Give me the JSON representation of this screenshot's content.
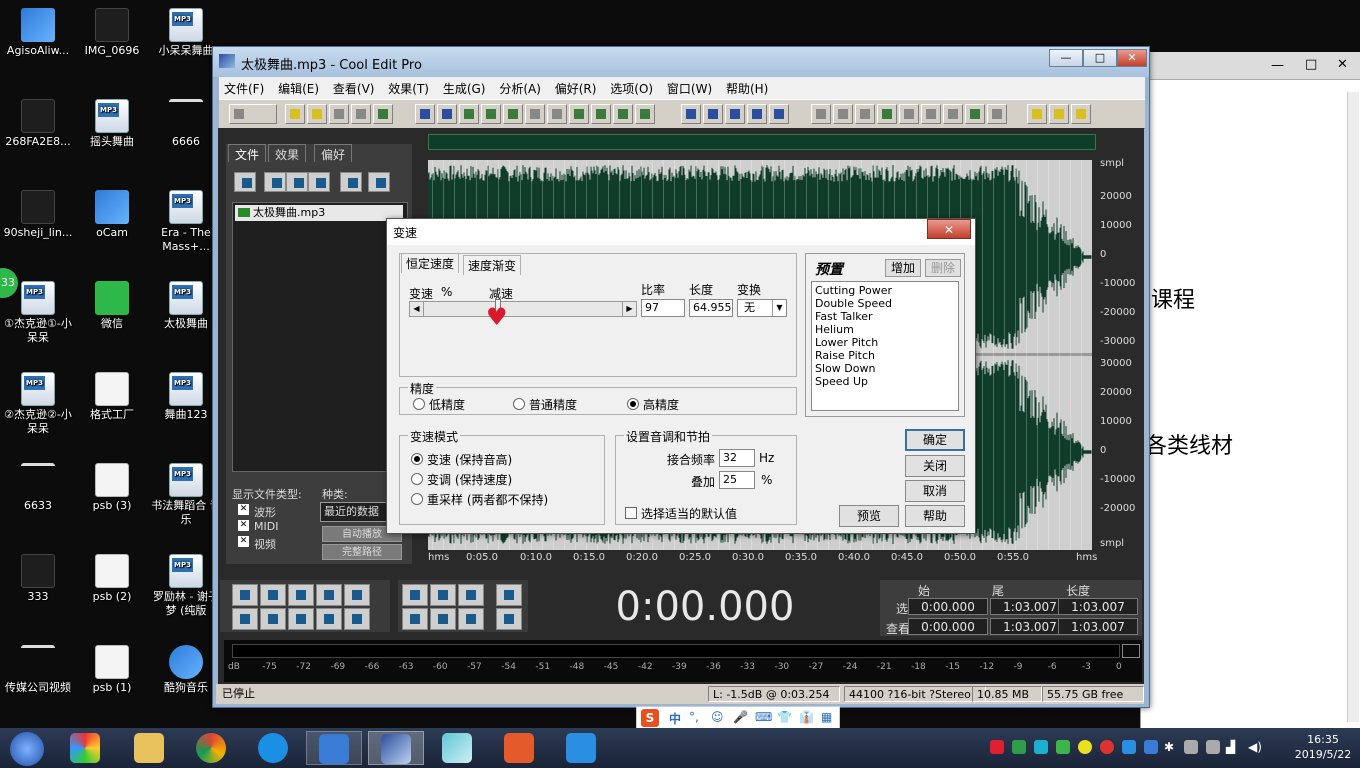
{
  "desktop": {
    "icons": [
      {
        "label": "AgisoAliw...",
        "icon": "mail-app-icon"
      },
      {
        "label": "IMG_0696",
        "icon": "image-file-icon"
      },
      {
        "label": "小呆呆舞曲",
        "icon": "mp3-file-icon"
      },
      {
        "label": "268FA2E8...",
        "icon": "image-file-icon"
      },
      {
        "label": "摇头舞曲",
        "icon": "mp3-file-icon"
      },
      {
        "label": "6666",
        "icon": "file-icon"
      },
      {
        "label": "90sheji_lin...",
        "icon": "image-file-icon"
      },
      {
        "label": "oCam",
        "icon": "ocam-app-icon"
      },
      {
        "label": "Era - The Mass+...",
        "icon": "mp3-file-icon"
      },
      {
        "label": "①杰克逊①-小呆呆",
        "icon": "mp3-file-icon"
      },
      {
        "label": "微信",
        "icon": "wechat-app-icon"
      },
      {
        "label": "太极舞曲",
        "icon": "mp3-file-icon"
      },
      {
        "label": "②杰克逊②-小呆呆",
        "icon": "mp3-file-icon"
      },
      {
        "label": "格式工厂",
        "icon": "format-factory-icon"
      },
      {
        "label": "舞曲123",
        "icon": "mp3-file-icon"
      },
      {
        "label": "6633",
        "icon": "file-icon"
      },
      {
        "label": "psb (3)",
        "icon": "document-icon"
      },
      {
        "label": "书法舞蹈合 音乐",
        "icon": "mp3-file-icon"
      },
      {
        "label": "333",
        "icon": "image-file-icon"
      },
      {
        "label": "psb (2)",
        "icon": "document-icon"
      },
      {
        "label": "罗励林 - 谢子梦 (纯版",
        "icon": "mp3-file-icon"
      },
      {
        "label": "传媒公司视频",
        "icon": "file-icon"
      },
      {
        "label": "psb (1)",
        "icon": "document-icon"
      },
      {
        "label": "酷狗音乐",
        "icon": "kugou-app-icon"
      }
    ],
    "badge": "33"
  },
  "bg_window": {
    "text1": "课程",
    "text2": "各类线材"
  },
  "app": {
    "title": "太极舞曲.mp3 - Cool Edit Pro",
    "win_buttons": [
      "—",
      "□",
      "✕"
    ],
    "menu": [
      "文件(F)",
      "编辑(E)",
      "查看(V)",
      "效果(T)",
      "生成(G)",
      "分析(A)",
      "偏好(R)",
      "选项(O)",
      "窗口(W)",
      "帮助(H)"
    ],
    "left_tabs": [
      "文件",
      "效果",
      "偏好"
    ],
    "file_item": "太极舞曲.mp3",
    "file_type_label": "显示文件类型:",
    "kind_label": "种类:",
    "file_types": [
      "波形",
      "MIDI",
      "视频"
    ],
    "recent_label": "最近的数据",
    "auto_play": "自动播放",
    "full_path": "完整路径",
    "y_ticks_top": [
      "smpl",
      "20000",
      "10000",
      "0",
      "-10000",
      "-20000",
      "-30000"
    ],
    "y_ticks_bottom": [
      "30000",
      "20000",
      "10000",
      "0",
      "-10000",
      "-20000",
      "smpl"
    ],
    "x_ticks": [
      "hms",
      "0:05.0",
      "0:10.0",
      "0:15.0",
      "0:20.0",
      "0:25.0",
      "0:30.0",
      "0:35.0",
      "0:40.0",
      "0:45.0",
      "0:50.0",
      "0:55.0",
      "hms"
    ],
    "time_display": "0:00.000",
    "sel": {
      "h_start": "始",
      "h_end": "尾",
      "h_len": "长度",
      "row1": "选",
      "row2": "查看",
      "sel_start": "0:00.000",
      "sel_end": "1:03.007",
      "sel_len": "1:03.007",
      "view_start": "0:00.000",
      "view_end": "1:03.007",
      "view_len": "1:03.007"
    },
    "meter_ticks": [
      "dB",
      "-75",
      "-72",
      "-69",
      "-66",
      "-63",
      "-60",
      "-57",
      "-54",
      "-51",
      "-48",
      "-45",
      "-42",
      "-39",
      "-36",
      "-33",
      "-30",
      "-27",
      "-24",
      "-21",
      "-18",
      "-15",
      "-12",
      "-9",
      "-6",
      "-3",
      "0"
    ],
    "status": {
      "state": "已停止",
      "level": "L: -1.5dB @   0:03.254",
      "format": "44100 ?16-bit ?Stereo",
      "size": "10.85 MB",
      "free": "55.75 GB free"
    }
  },
  "dialog": {
    "title": "变速",
    "close": "✕",
    "tabs": [
      "恒定速度",
      "速度渐变"
    ],
    "speed_label": "变速",
    "pct": "%",
    "slow_label": "减速",
    "ratio_label": "比率",
    "length_label": "长度",
    "transpose_label": "变换",
    "ratio_value": "97",
    "length_value": "64.955",
    "transpose_value": "无",
    "precision_label": "精度",
    "precision_options": [
      "低精度",
      "普通精度",
      "高精度"
    ],
    "precision_selected": 2,
    "mode_label": "变速模式",
    "mode_options": [
      "变速 (保持音高)",
      "变调 (保持速度)",
      "重采样 (两者都不保持)"
    ],
    "mode_selected": 0,
    "pitch_label": "设置音调和节拍",
    "splice_label": "接合频率",
    "splice_value": "32",
    "splice_unit": "Hz",
    "overlap_label": "叠加",
    "overlap_value": "25",
    "overlap_unit": "%",
    "default_check": "选择适当的默认值",
    "preset_title": "预置",
    "add_btn": "增加",
    "delete_btn": "删除",
    "presets": [
      "Cutting Power",
      "Double Speed",
      "Fast Talker",
      "Helium",
      "Lower Pitch",
      "Raise Pitch",
      "Slow Down",
      "Speed Up"
    ],
    "ok": "确定",
    "close_btn": "关闭",
    "cancel": "取消",
    "preview": "预览",
    "help": "帮助",
    "slider_fraction": 0.37
  },
  "ime": {
    "logo": "S",
    "mode": "中",
    "items": [
      "°,",
      "☺",
      "🎤",
      "⌨",
      "👕",
      "👔",
      "▦"
    ]
  },
  "taskbar": {
    "time": "16:35",
    "date": "2019/5/22",
    "apps": [
      "start-orb-icon",
      "pinwheel-icon",
      "folder-icon",
      "chrome-icon",
      "kugou-icon",
      "mail-icon",
      "cool-edit-icon",
      "glass-icon",
      "office-icon",
      "shield-icon"
    ]
  }
}
